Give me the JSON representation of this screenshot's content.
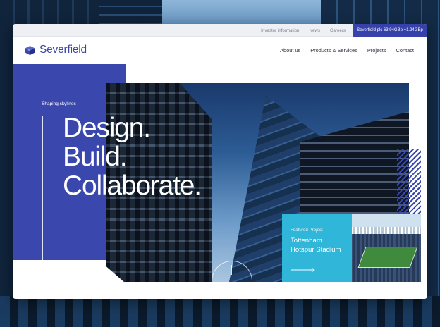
{
  "utility": {
    "links": [
      "Investor information",
      "News",
      "Careers"
    ],
    "share_price": "Severfield plc 63.94GBp +1.94GBp"
  },
  "brand": {
    "name": "Severfield",
    "accent_color": "#3a47ad",
    "featured_color": "#2fb6d8"
  },
  "nav": {
    "items": [
      "About us",
      "Products & Services",
      "Projects",
      "Contact"
    ]
  },
  "hero": {
    "eyebrow": "Shaping skylines",
    "headline": [
      "Design.",
      "Build.",
      "Collaborate."
    ]
  },
  "featured": {
    "label": "Featured Project",
    "title": "Tottenham Hotspur Stadium",
    "arrow_icon": "arrow-right-icon"
  }
}
